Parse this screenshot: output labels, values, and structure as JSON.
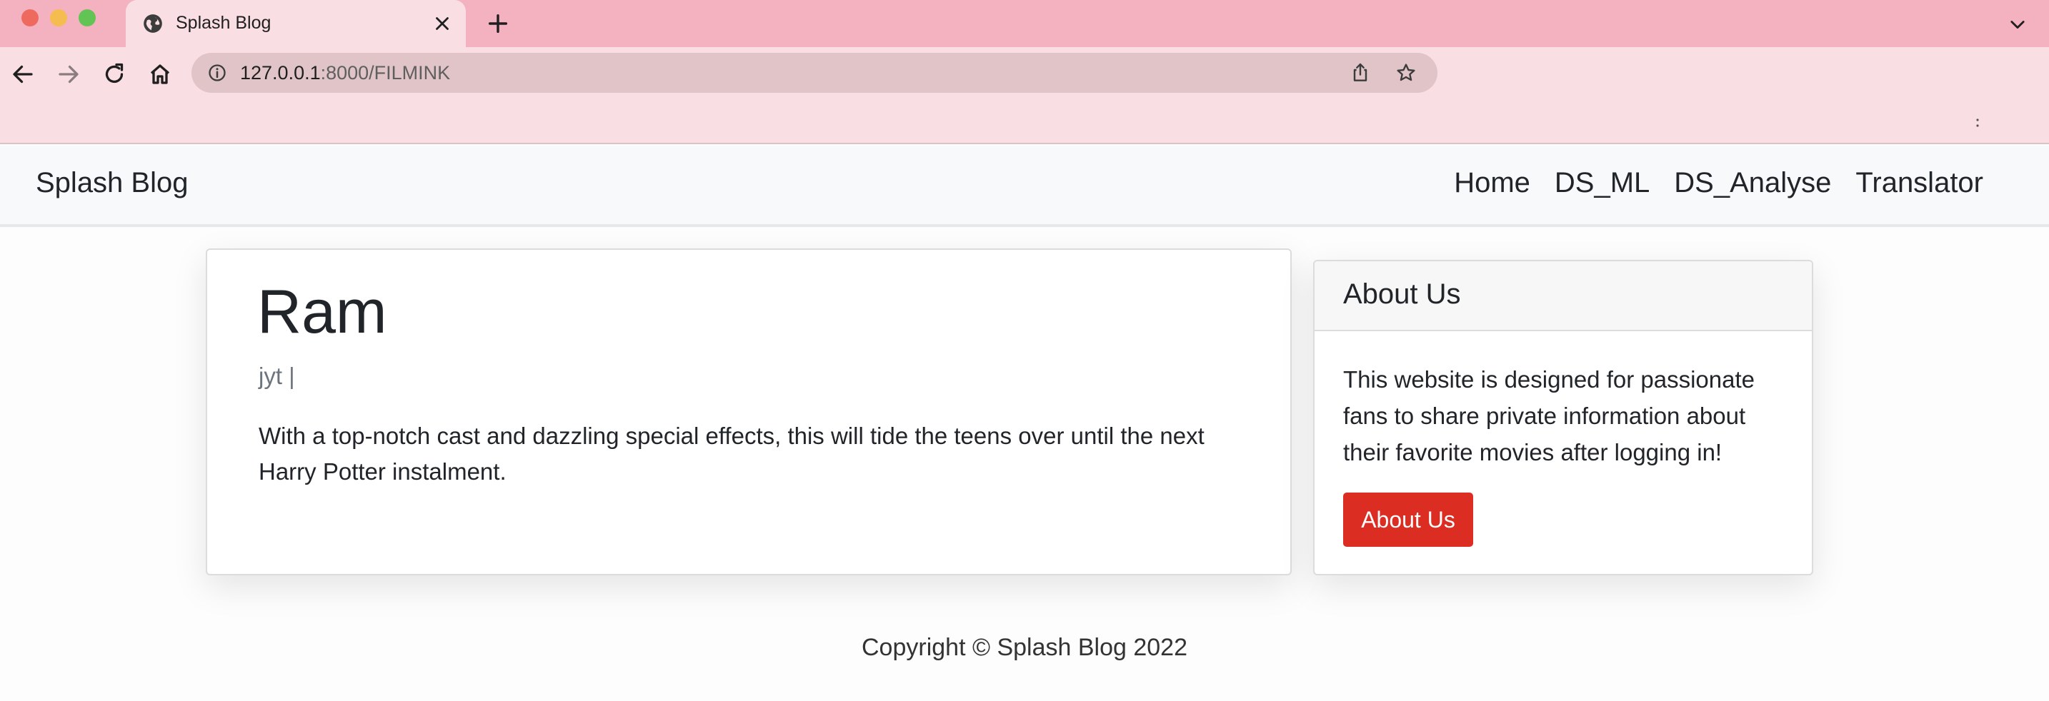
{
  "browser": {
    "tab_title": "Splash Blog",
    "url_host": "127.0.0.1",
    "url_rest": ":8000/FILMINK"
  },
  "site": {
    "brand": "Splash Blog",
    "nav": [
      "Home",
      "DS_ML",
      "DS_Analyse",
      "Translator"
    ]
  },
  "post": {
    "title": "Ram",
    "meta": "jyt |",
    "body": "With a top-notch cast and dazzling special effects, this will tide the teens over until the next Harry Potter instalment."
  },
  "sidebar": {
    "header": "About Us",
    "text": "This website is designed for passionate fans to share private information about their favorite movies after logging in!",
    "button_label": "About Us"
  },
  "footer": {
    "text": "Copyright © Splash Blog 2022"
  },
  "colors": {
    "tab_strip": "#f4b1bf",
    "toolbar": "#f9dfe4",
    "accent_button": "#dc2d23"
  }
}
